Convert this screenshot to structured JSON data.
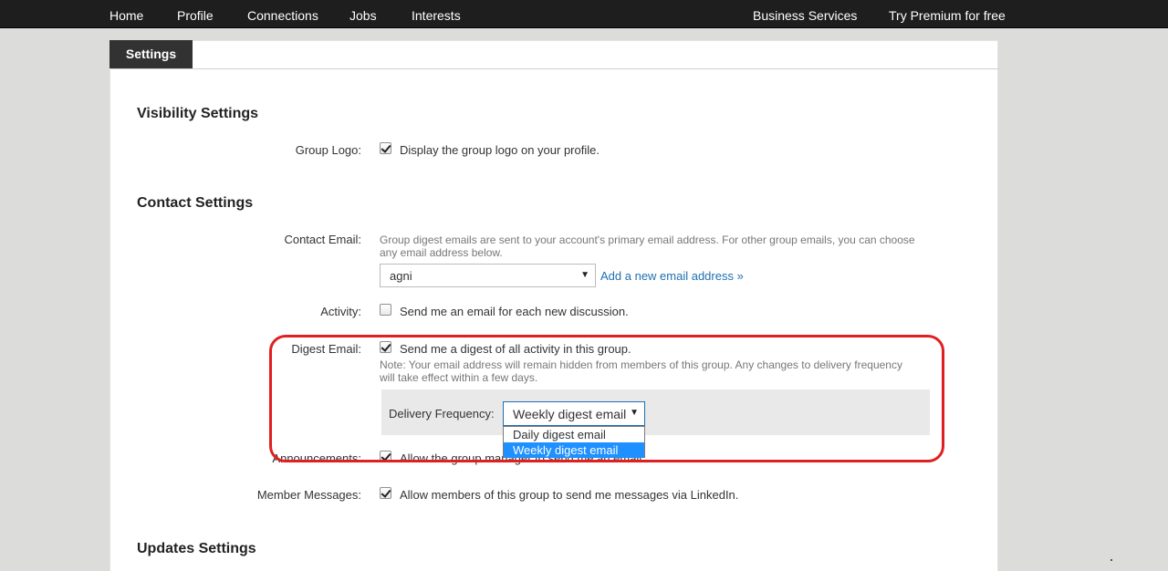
{
  "nav": {
    "left": [
      "Home",
      "Profile",
      "Connections",
      "Jobs",
      "Interests"
    ],
    "business": "Business Services",
    "premium": "Try Premium for free"
  },
  "tab_label": "Settings",
  "visibility": {
    "heading": "Visibility Settings",
    "group_logo_label": "Group Logo:",
    "group_logo_text": "Display the group logo on your profile.",
    "group_logo_checked": true
  },
  "contact": {
    "heading": "Contact Settings",
    "email_label": "Contact Email:",
    "email_note_line1": "Group digest emails are sent to your account's primary email address. For other group emails, you can choose",
    "email_note_line2": "any email address below.",
    "email_value": "agni",
    "add_email_link": "Add a new email address »",
    "activity_label": "Activity:",
    "activity_text": "Send me an email for each new discussion.",
    "activity_checked": false,
    "digest_label": "Digest Email:",
    "digest_text": "Send me a digest of all activity in this group.",
    "digest_checked": true,
    "digest_note_line1": "Note: Your email address will remain hidden from members of this group. Any changes to delivery frequency",
    "digest_note_line2": "will take effect within a few days.",
    "frequency_label": "Delivery Frequency:",
    "frequency_value": "Weekly digest email",
    "frequency_options": [
      "Daily digest email",
      "Weekly digest email"
    ],
    "announcements_label": "Announcements:",
    "announcements_text": "Allow the group manager to send me an email.",
    "announcements_checked": true,
    "member_messages_label": "Member Messages:",
    "member_messages_text": "Allow members of this group to send me messages via LinkedIn.",
    "member_messages_checked": true
  },
  "updates": {
    "heading": "Updates Settings"
  },
  "colors": {
    "highlight_ring": "#e02020",
    "link": "#1f6fb2",
    "dropdown_selected": "#1e90ff"
  }
}
